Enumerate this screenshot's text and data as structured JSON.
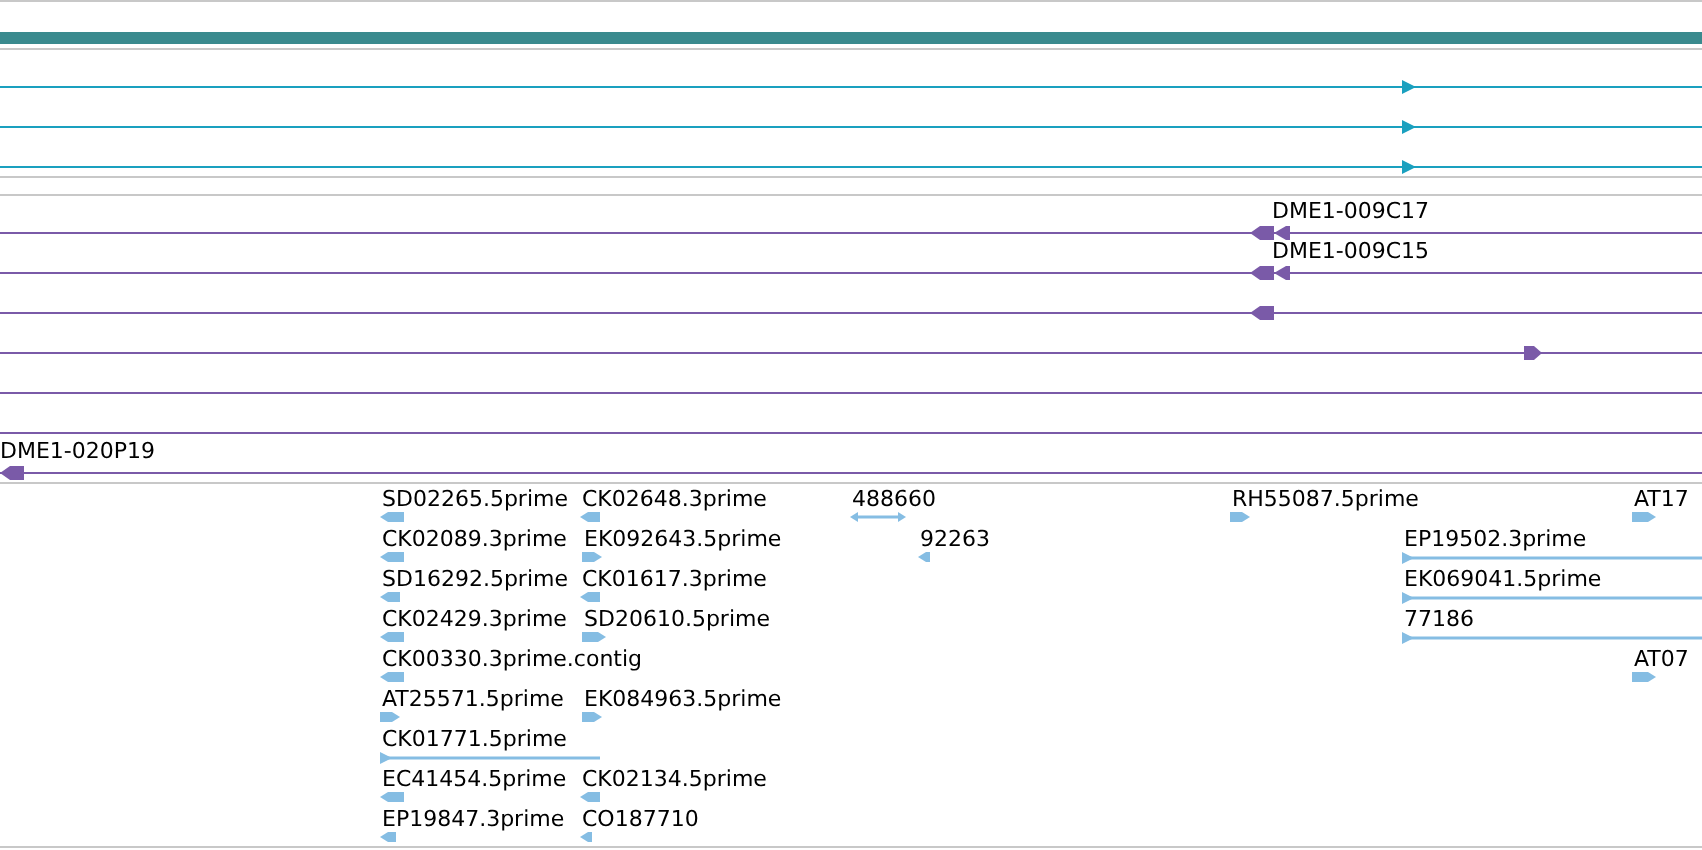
{
  "contig_track": {
    "rows": [
      {
        "kind": "forward"
      },
      {
        "kind": "forward"
      },
      {
        "kind": "forward"
      }
    ]
  },
  "clone_track": {
    "rows": [
      {
        "label": "DME1-009C17",
        "kind": "reverse"
      },
      {
        "label": "DME1-009C15",
        "kind": "reverse"
      },
      {
        "kind": "reverse"
      },
      {
        "kind": "forward"
      },
      {
        "kind": "plain"
      },
      {
        "kind": "plain"
      },
      {
        "label": "DME1-020P19",
        "kind": "reverse"
      }
    ]
  },
  "est_track": {
    "features": [
      {
        "label": "SD02265.5prime",
        "kind": "reverse"
      },
      {
        "label": "CK02648.3prime",
        "kind": "reverse"
      },
      {
        "label": "488660",
        "kind": "bidirectional"
      },
      {
        "label": "RH55087.5prime",
        "kind": "forward"
      },
      {
        "label": "AT17",
        "kind": "forward"
      },
      {
        "label": "CK02089.3prime",
        "kind": "reverse"
      },
      {
        "label": "EK092643.5prime",
        "kind": "forward"
      },
      {
        "label": "92263",
        "kind": "reverse"
      },
      {
        "label": "EP19502.3prime",
        "kind": "forward"
      },
      {
        "label": "SD16292.5prime",
        "kind": "reverse"
      },
      {
        "label": "CK01617.3prime",
        "kind": "reverse"
      },
      {
        "label": "EK069041.5prime",
        "kind": "forward"
      },
      {
        "label": "CK02429.3prime",
        "kind": "reverse"
      },
      {
        "label": "SD20610.5prime",
        "kind": "forward"
      },
      {
        "label": "77186",
        "kind": "forward"
      },
      {
        "label": "CK00330.3prime.contig",
        "kind": "reverse"
      },
      {
        "label": "AT07",
        "kind": "forward"
      },
      {
        "label": "AT25571.5prime",
        "kind": "forward"
      },
      {
        "label": "EK084963.5prime",
        "kind": "forward"
      },
      {
        "label": "CK01771.5prime",
        "kind": "forward"
      },
      {
        "label": "EC41454.5prime",
        "kind": "reverse"
      },
      {
        "label": "CK02134.5prime",
        "kind": "reverse"
      },
      {
        "label": "EP19847.3prime",
        "kind": "reverse"
      },
      {
        "label": "CO187710",
        "kind": "reverse"
      }
    ]
  }
}
